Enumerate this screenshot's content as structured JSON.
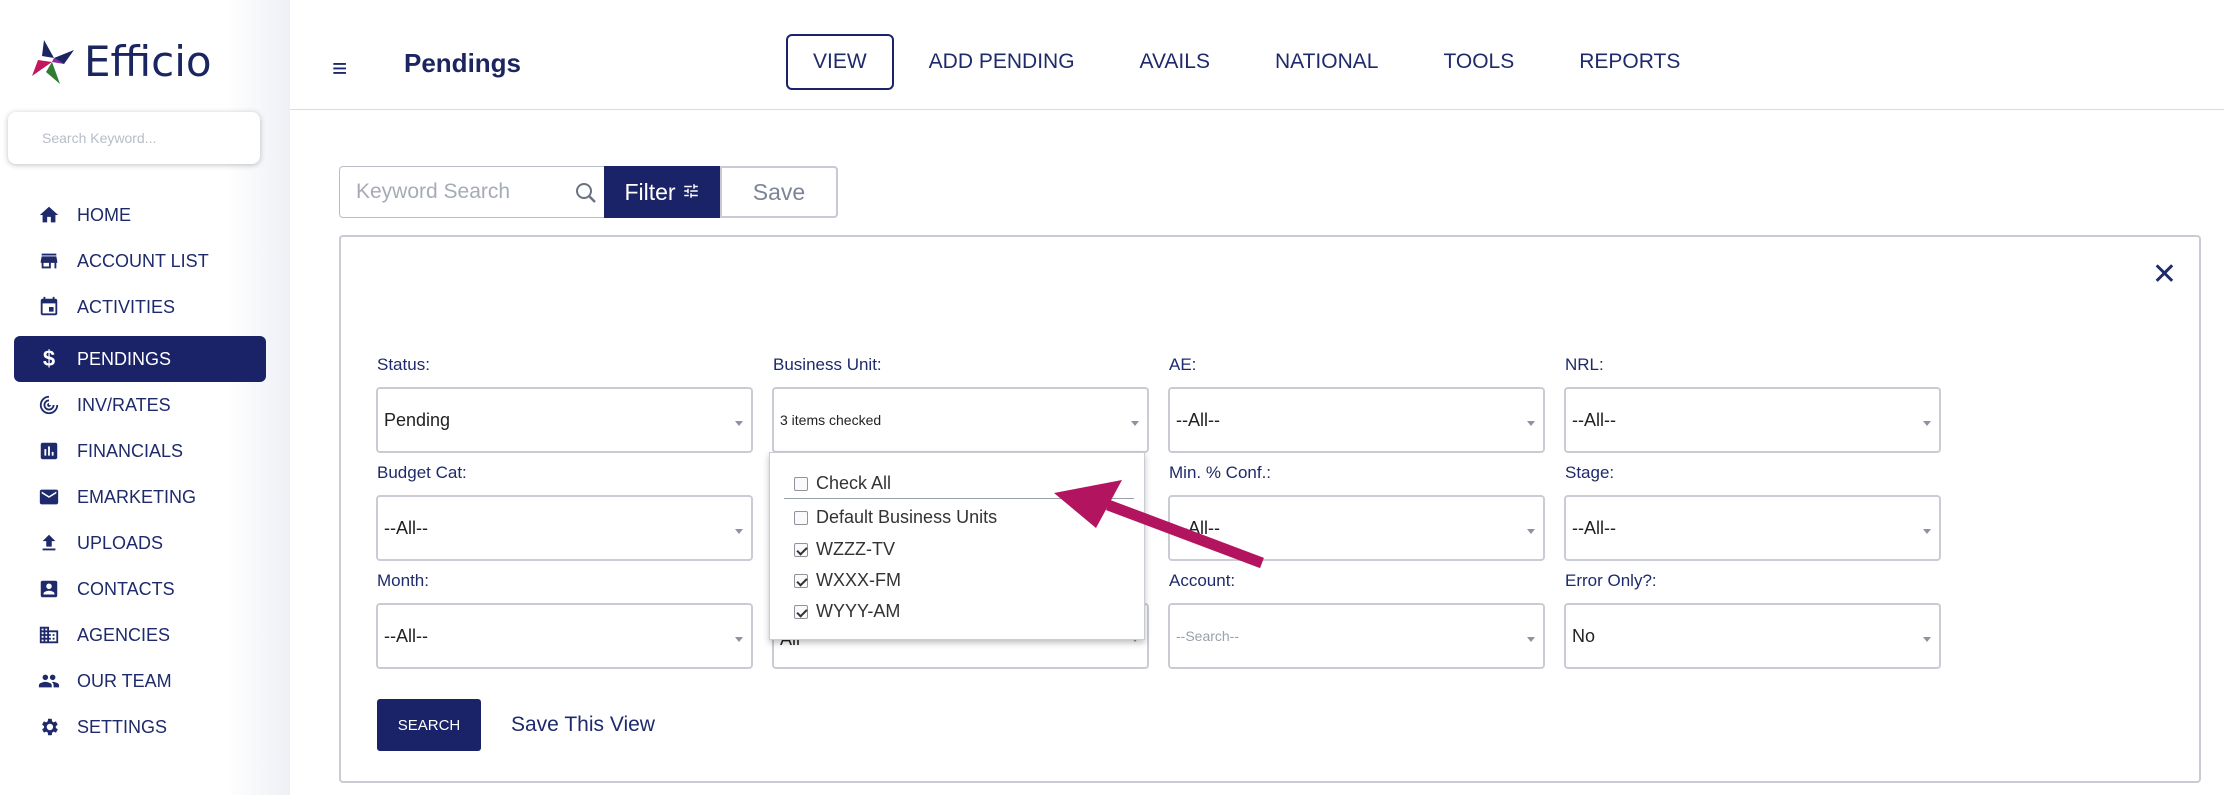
{
  "app": {
    "brand": "Efficio"
  },
  "sidebar": {
    "search_placeholder": "Search Keyword...",
    "items": [
      {
        "label": "HOME",
        "icon": "home-icon"
      },
      {
        "label": "ACCOUNT LIST",
        "icon": "store-icon"
      },
      {
        "label": "ACTIVITIES",
        "icon": "calendar-icon"
      },
      {
        "label": "PENDINGS",
        "icon": "dollar-icon",
        "active": true
      },
      {
        "label": "INV/RATES",
        "icon": "radar-icon"
      },
      {
        "label": "FINANCIALS",
        "icon": "bar-chart-icon"
      },
      {
        "label": "EMARKETING",
        "icon": "mail-icon"
      },
      {
        "label": "UPLOADS",
        "icon": "upload-icon"
      },
      {
        "label": "CONTACTS",
        "icon": "contact-card-icon"
      },
      {
        "label": "AGENCIES",
        "icon": "building-icon"
      },
      {
        "label": "OUR TEAM",
        "icon": "people-icon"
      },
      {
        "label": "SETTINGS",
        "icon": "gear-icon"
      }
    ]
  },
  "header": {
    "title": "Pendings",
    "tabs": [
      "VIEW",
      "ADD PENDING",
      "AVAILS",
      "NATIONAL",
      "TOOLS",
      "REPORTS"
    ]
  },
  "toolbar": {
    "keyword_placeholder": "Keyword Search",
    "filter_label": "Filter",
    "save_label": "Save"
  },
  "filters": {
    "status": {
      "label": "Status:",
      "value": "Pending"
    },
    "business_unit": {
      "label": "Business Unit:",
      "value": "3 items checked"
    },
    "ae": {
      "label": "AE:",
      "value": "--All--"
    },
    "nrl": {
      "label": "NRL:",
      "value": "--All--"
    },
    "budget_cat": {
      "label": "Budget Cat:",
      "value": "--All--"
    },
    "min_conf": {
      "label": "Min. % Conf.:",
      "value": "--All--"
    },
    "stage": {
      "label": "Stage:",
      "value": "--All--"
    },
    "month": {
      "label": "Month:",
      "value": "--All--"
    },
    "hidden_under_dropdown": {
      "value": "All"
    },
    "account": {
      "label": "Account:",
      "value": "--Search--"
    },
    "error_only": {
      "label": "Error Only?:",
      "value": "No"
    }
  },
  "business_unit_dropdown": {
    "check_all": "Check All",
    "items": [
      {
        "label": "Default Business Units",
        "checked": false
      },
      {
        "label": "WZZZ-TV",
        "checked": true
      },
      {
        "label": "WXXX-FM",
        "checked": true
      },
      {
        "label": "WYYY-AM",
        "checked": true
      }
    ]
  },
  "actions": {
    "search_label": "SEARCH",
    "save_view_label": "Save This View"
  },
  "colors": {
    "primary": "#1b2368",
    "annotation_arrow": "#b3145f"
  }
}
